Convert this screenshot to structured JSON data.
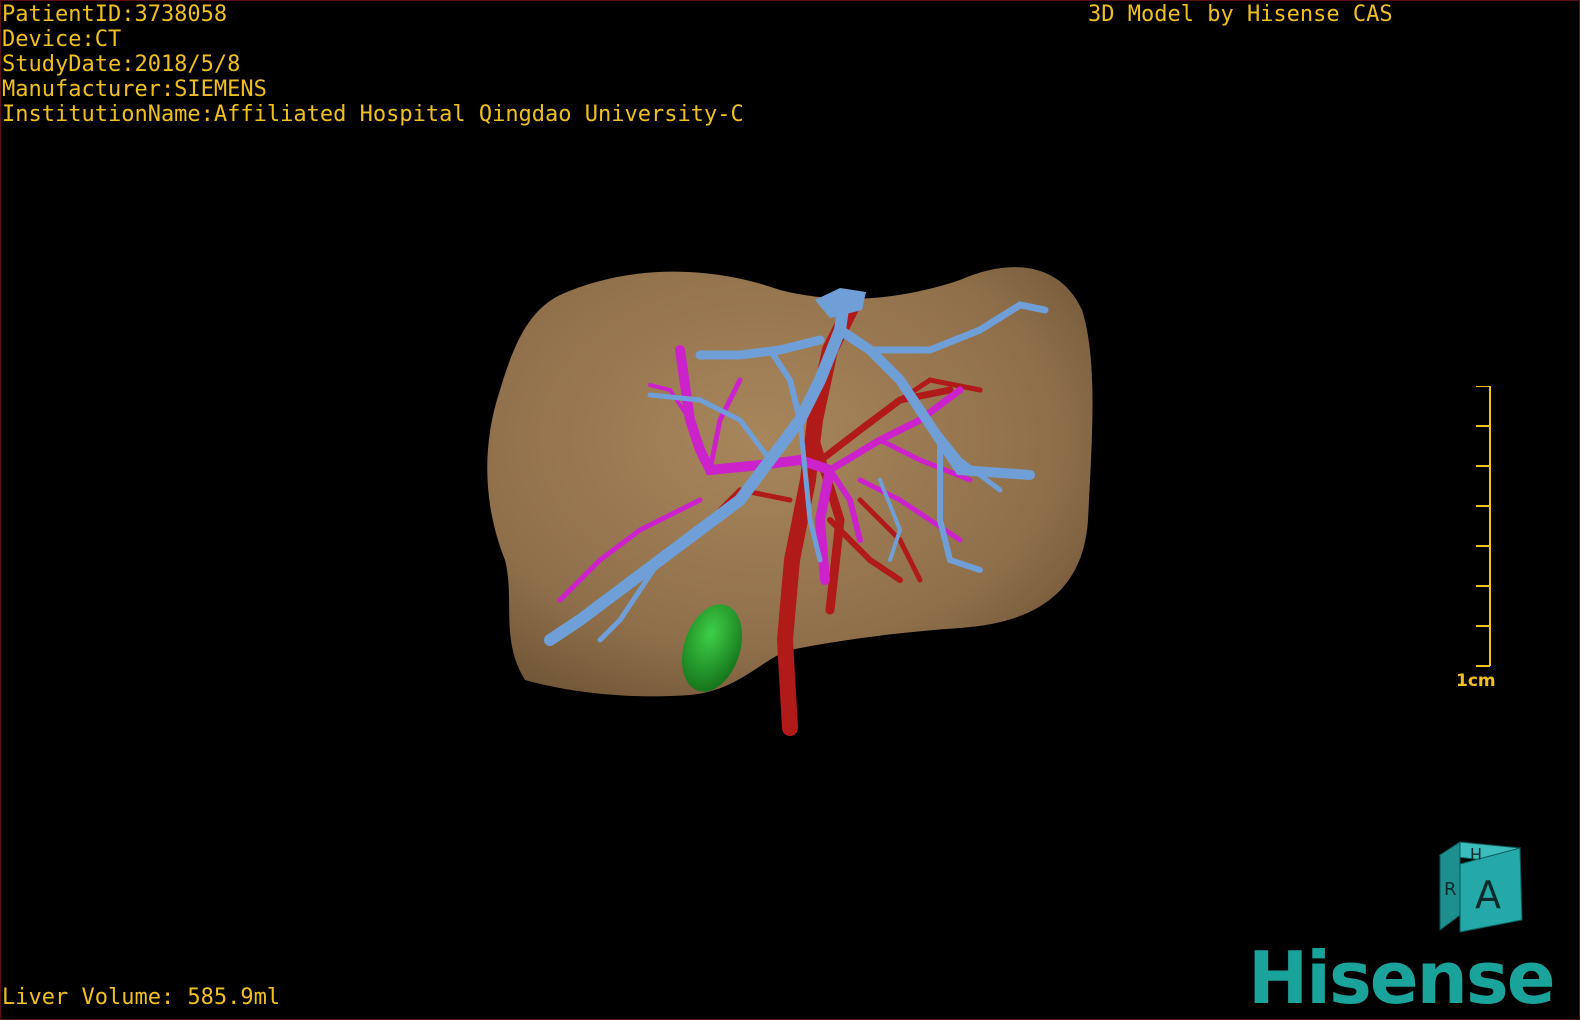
{
  "patient_info": {
    "patient_id": "PatientID:3738058",
    "device": "Device:CT",
    "study_date": "StudyDate:2018/5/8",
    "manufacturer": "Manufacturer:SIEMENS",
    "institution": "InstitutionName:Affiliated Hospital Qingdao University-C"
  },
  "credit": "3D Model by Hisense CAS",
  "liver_volume": "Liver Volume: 585.9ml",
  "scale": {
    "label": "1cm"
  },
  "orientation_cube": {
    "front_label": "A",
    "top_label": "H",
    "side_label": "R"
  },
  "logo": "Hisense",
  "colors": {
    "text": "#f0c020",
    "liver": "#9b7a52",
    "portal_vein": "#6f9fd6",
    "hepatic_vein": "#cc22cc",
    "artery": "#b01a18",
    "gallbladder": "#1f9a2a",
    "logo": "#1aa39a"
  }
}
